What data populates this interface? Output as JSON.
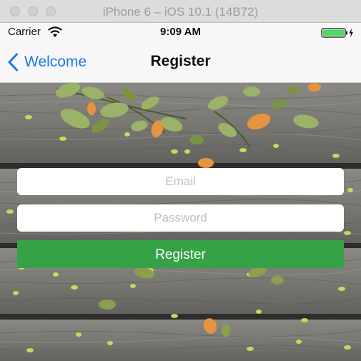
{
  "simulator": {
    "window_title": "iPhone 6 – iOS 10.1 (14B72)"
  },
  "status_bar": {
    "carrier": "Carrier",
    "time": "9:09 AM",
    "battery_color": "#4cd964",
    "wifi_icon": "wifi-icon",
    "battery_icon": "battery-charging-icon"
  },
  "nav_bar": {
    "back_label": "Welcome",
    "back_icon": "chevron-left-icon",
    "title": "Register"
  },
  "form": {
    "email_placeholder": "Email",
    "email_value": "",
    "password_placeholder": "Password",
    "password_value": "",
    "register_label": "Register"
  },
  "colors": {
    "tint": "#1b7ae0",
    "register_button": "#36a246",
    "nav_background": "#f7f7f7"
  }
}
